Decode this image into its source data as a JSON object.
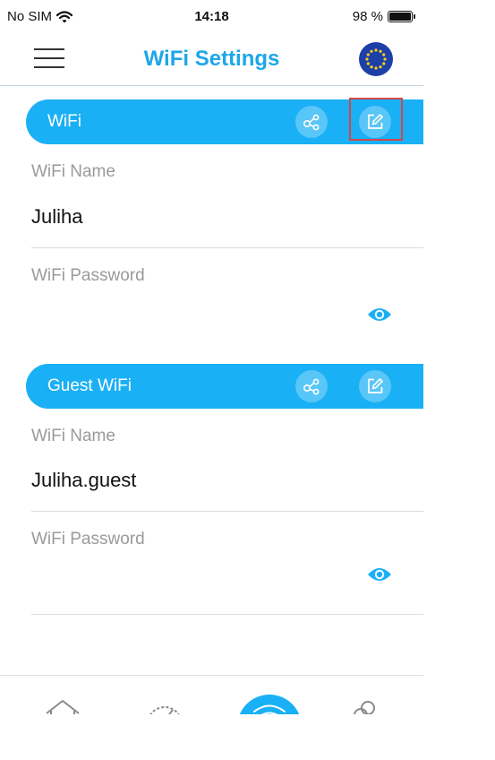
{
  "status_bar": {
    "carrier": "No SIM",
    "time": "14:18",
    "battery": "98 %",
    "battery_level": 0.98
  },
  "header": {
    "title": "WiFi Settings"
  },
  "sections": [
    {
      "label": "WiFi",
      "name_label": "WiFi Name",
      "name_value": "Juliha",
      "password_label": "WiFi Password"
    },
    {
      "label": "Guest WiFi",
      "name_label": "WiFi Name",
      "name_value": "Juliha.guest",
      "password_label": "WiFi Password"
    }
  ],
  "colors": {
    "accent": "#1ab0f5",
    "title": "#1da6e8",
    "highlight": "#d2464b",
    "eu_flag": "#1d3fa8"
  },
  "icons": [
    "menu-icon",
    "eu-flag-icon",
    "share-icon",
    "edit-icon",
    "eye-icon",
    "home-icon",
    "speedometer-icon",
    "wifi-icon",
    "users-icon"
  ]
}
